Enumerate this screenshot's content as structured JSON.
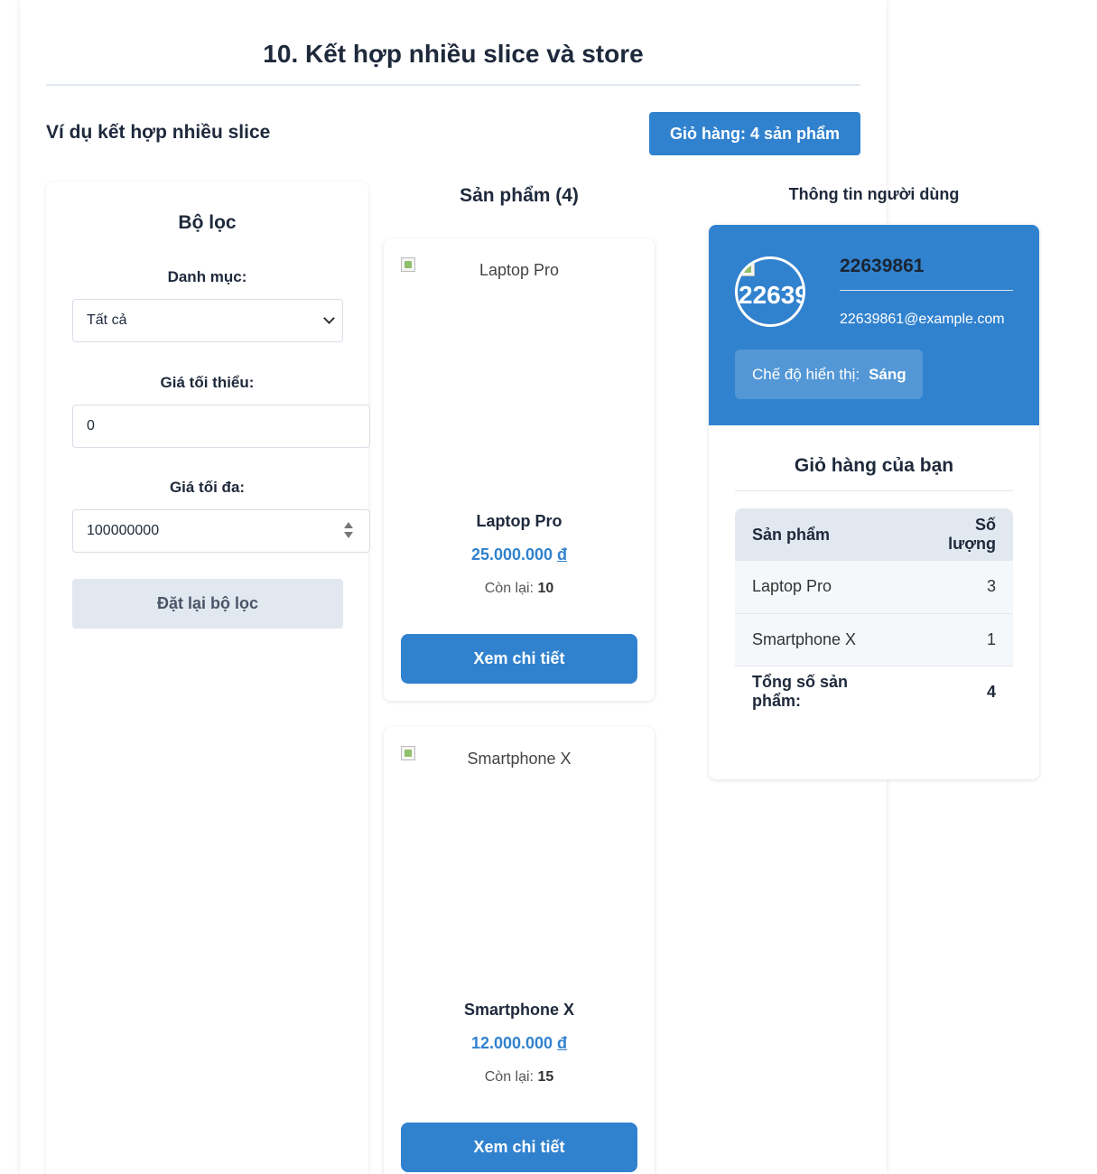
{
  "page": {
    "title": "10. Kết hợp nhiều slice và store",
    "subtitle": "Ví dụ kết hợp nhiều slice",
    "cart_button": "Giỏ hàng: 4 sản phẩm"
  },
  "filter": {
    "title": "Bộ lọc",
    "category_label": "Danh mục:",
    "category_value": "Tất cả",
    "min_price_label": "Giá tối thiểu:",
    "min_price_value": "0",
    "max_price_label": "Giá tối đa:",
    "max_price_value": "100000000",
    "reset_button": "Đặt lại bộ lọc"
  },
  "products": {
    "heading": "Sản phẩm (4)",
    "items": [
      {
        "name": "Laptop Pro",
        "image_alt": "Laptop Pro",
        "price": "25.000.000",
        "currency": "đ",
        "stock_label": "Còn lại:",
        "stock": "10",
        "button": "Xem chi tiết"
      },
      {
        "name": "Smartphone X",
        "image_alt": "Smartphone X",
        "price": "12.000.000",
        "currency": "đ",
        "stock_label": "Còn lại:",
        "stock": "15",
        "button": "Xem chi tiết"
      }
    ]
  },
  "user": {
    "heading": "Thông tin người dùng",
    "avatar_alt": "22639861",
    "name": "22639861",
    "email": "22639861@example.com",
    "mode_label": "Chế độ hiển thị:",
    "mode_value": "Sáng"
  },
  "cart": {
    "title": "Giỏ hàng của bạn",
    "col_product": "Sản phẩm",
    "col_quantity": "Số lượng",
    "rows": [
      {
        "product": "Laptop Pro",
        "quantity": "3"
      },
      {
        "product": "Smartphone X",
        "quantity": "1"
      }
    ],
    "total_label": "Tổng số sản phẩm:",
    "total_value": "4"
  },
  "colors": {
    "primary": "#3182ce",
    "text": "#1e293b",
    "muted_bg": "#e2e8f0"
  }
}
